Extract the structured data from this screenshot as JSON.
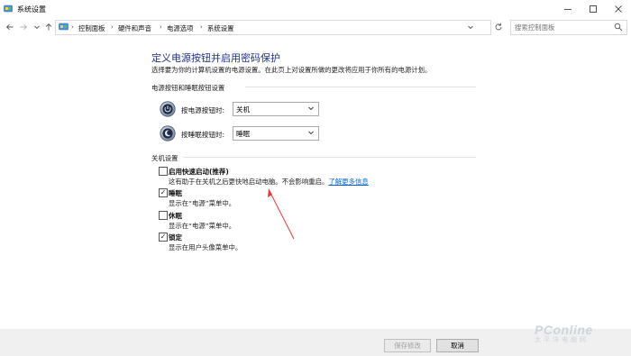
{
  "window": {
    "title": "系统设置",
    "icon": "control-panel-icon"
  },
  "nav": {
    "back_icon": "arrow-left-icon",
    "forward_icon": "arrow-right-icon",
    "dropdown_icon": "chevron-down-icon",
    "up_icon": "arrow-up-icon"
  },
  "breadcrumb": [
    "控制面板",
    "硬件和声音",
    "电源选项",
    "系统设置"
  ],
  "search": {
    "placeholder": "搜索控制面板"
  },
  "page": {
    "heading": "定义电源按钮并启用密码保护",
    "description": "选择要为你的计算机设置的电源设置。在此页上对设置所做的更改将应用于你所有的电源计划。"
  },
  "power_section": {
    "title": "电源按钮和睡眠按钮设置",
    "rows": [
      {
        "label": "按电源按钮时:",
        "value": "关机",
        "icon": "power-button-icon"
      },
      {
        "label": "按睡眠按钮时:",
        "value": "睡眠",
        "icon": "sleep-button-icon"
      }
    ]
  },
  "shutdown_section": {
    "title": "关机设置",
    "options": [
      {
        "label": "启用快速启动(推荐)",
        "checked": false,
        "desc": "这有助于在关机之后更快地启动电脑。不会影响重启。",
        "link": "了解更多信息"
      },
      {
        "label": "睡眠",
        "checked": true,
        "desc": "显示在“电源”菜单中。"
      },
      {
        "label": "休眠",
        "checked": false,
        "desc": "显示在“电源”菜单中。"
      },
      {
        "label": "锁定",
        "checked": true,
        "desc": "显示在用户头像菜单中。"
      }
    ]
  },
  "footer": {
    "save_label": "保存修改",
    "cancel_label": "取消"
  },
  "watermark": {
    "brand": "PConline",
    "sub": "太平洋电脑网"
  },
  "colors": {
    "heading": "#1e3287",
    "link": "#0066cc",
    "annotation_arrow": "#e23a3a"
  }
}
